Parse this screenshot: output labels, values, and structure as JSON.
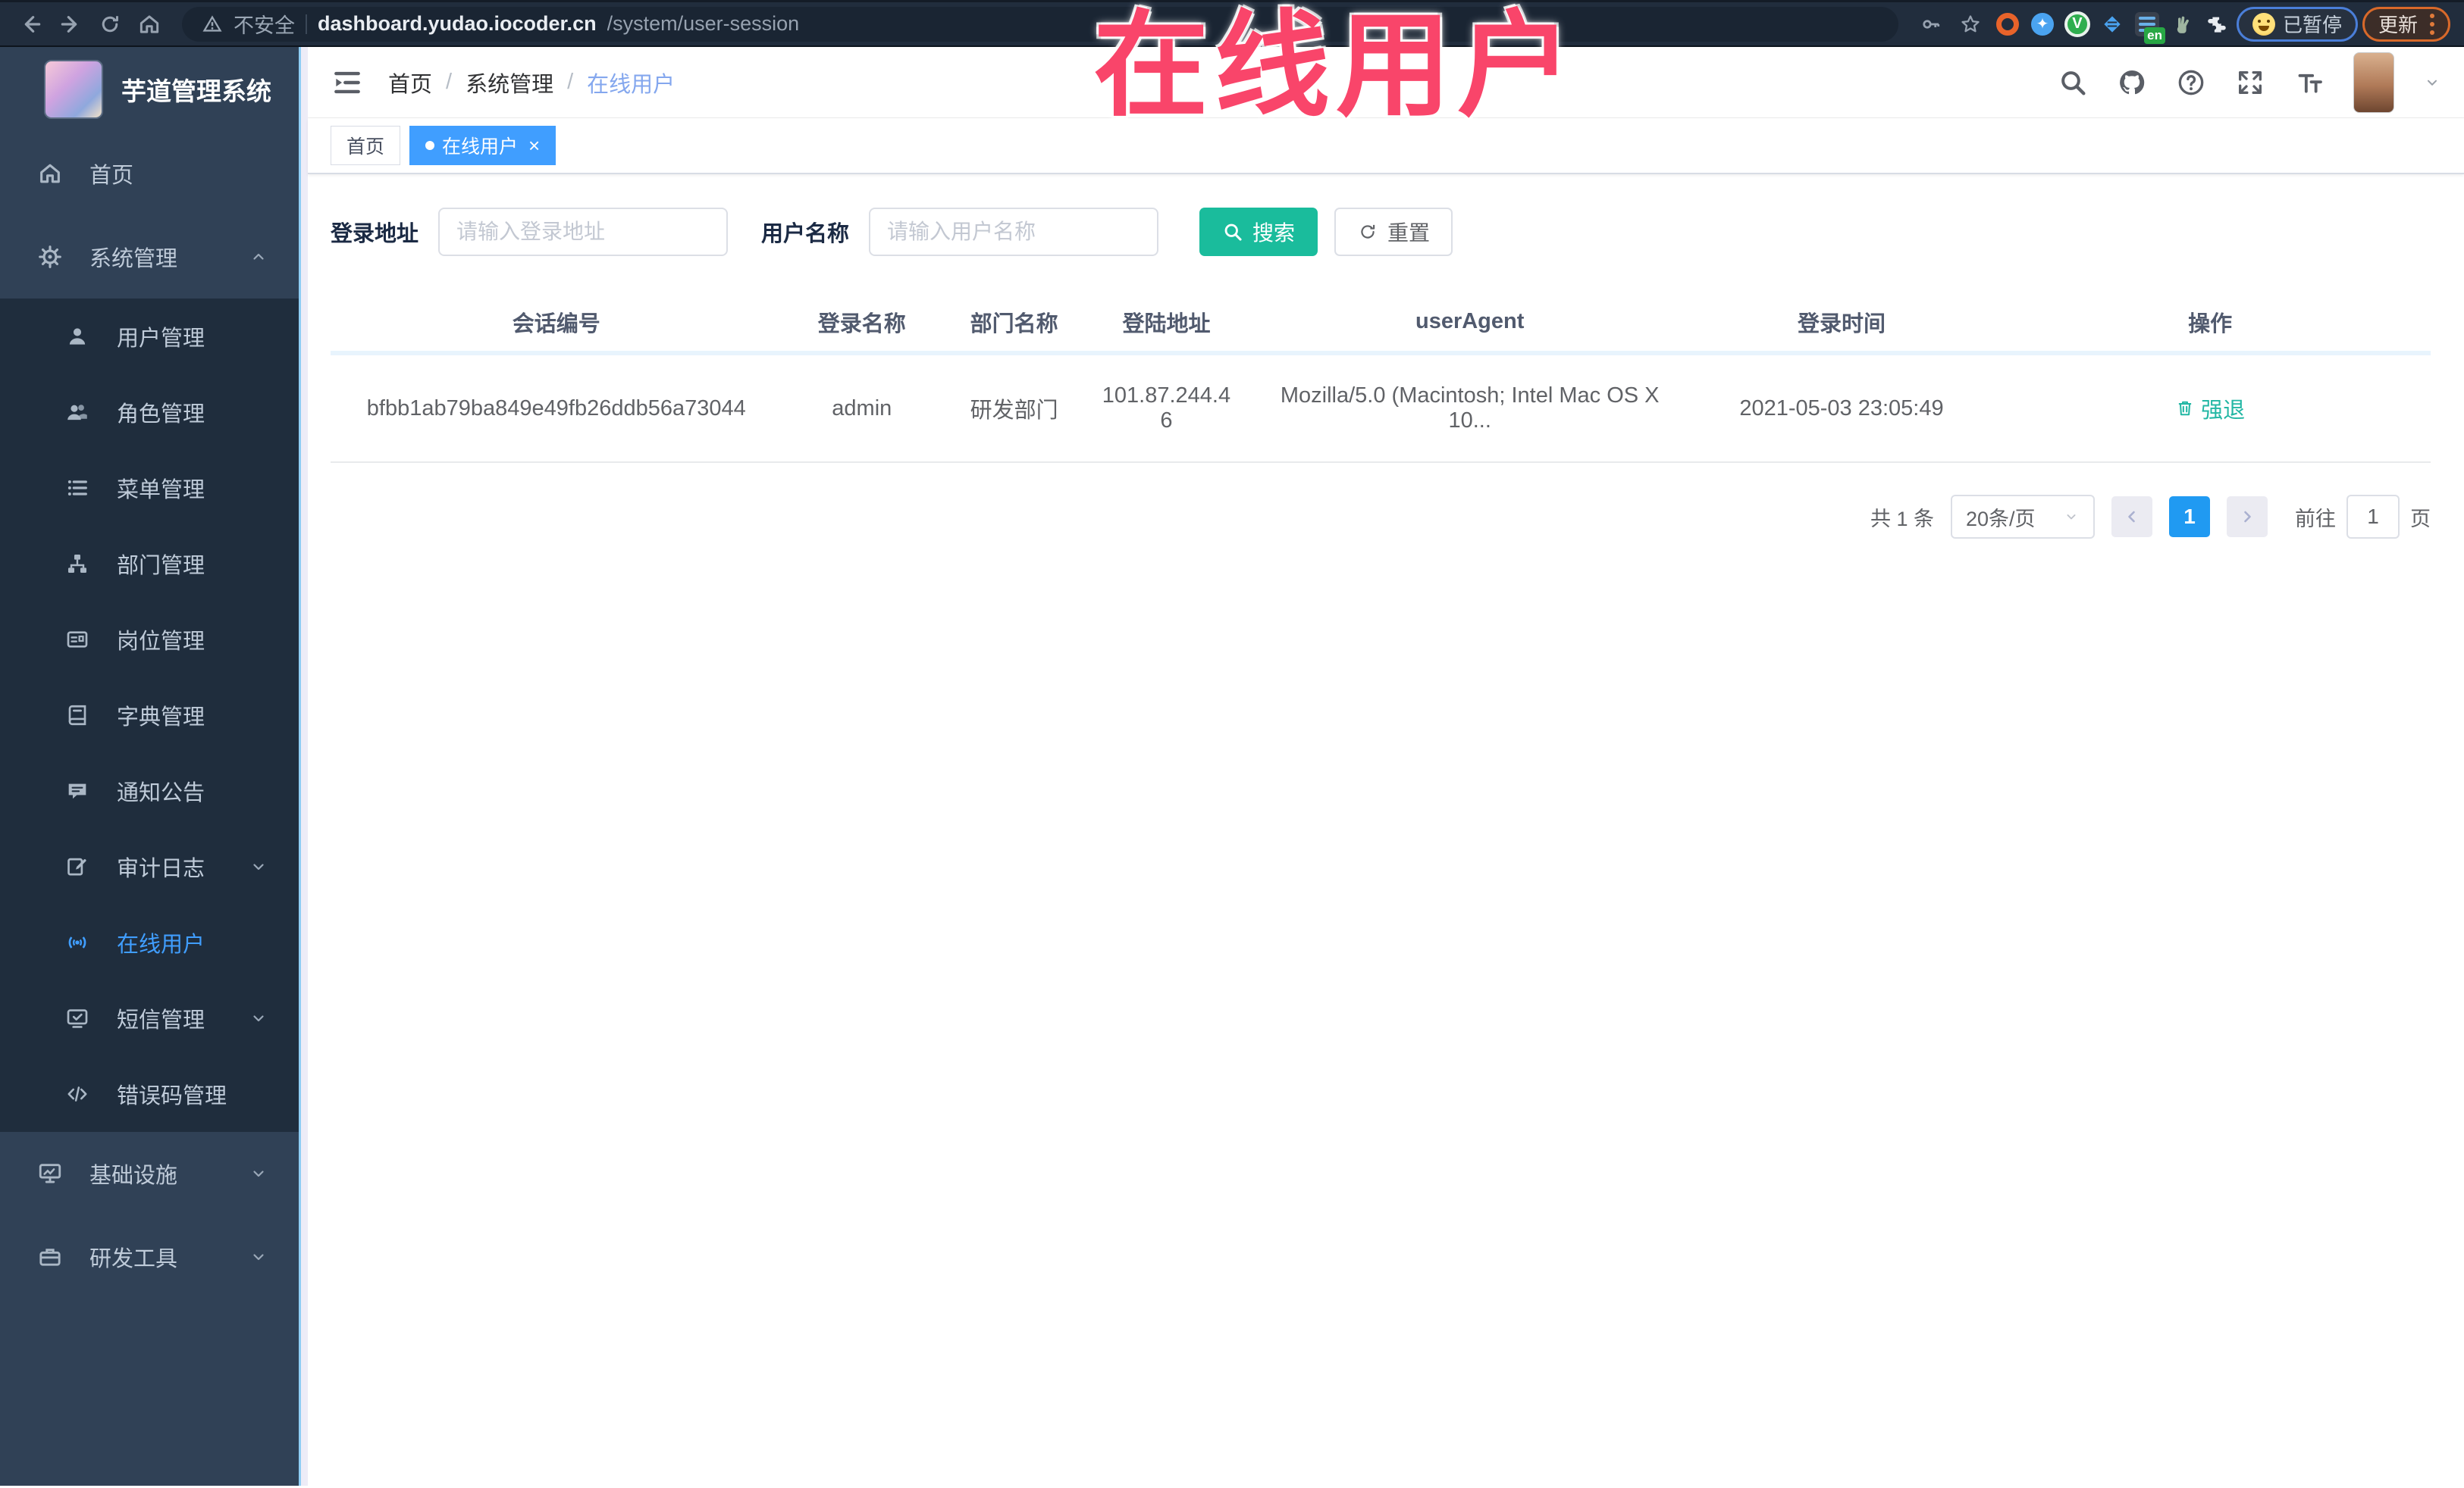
{
  "browser": {
    "security_label": "不安全",
    "url_domain": "dashboard.yudao.iocoder.cn",
    "url_path": "/system/user-session",
    "translate_badge": "en",
    "paused_badge": "已暂停",
    "update_button": "更新"
  },
  "watermark": {
    "text": "在线用户",
    "color": "#f9456a"
  },
  "sidebar": {
    "title": "芋道管理系统",
    "items": [
      {
        "label": "首页",
        "icon": "home-icon",
        "level": 1
      },
      {
        "label": "系统管理",
        "icon": "gear-icon",
        "level": 1,
        "caret": "up",
        "expanded": true
      },
      {
        "label": "用户管理",
        "icon": "user-icon",
        "level": 2
      },
      {
        "label": "角色管理",
        "icon": "users-icon",
        "level": 2
      },
      {
        "label": "菜单管理",
        "icon": "menu-list-icon",
        "level": 2
      },
      {
        "label": "部门管理",
        "icon": "org-tree-icon",
        "level": 2
      },
      {
        "label": "岗位管理",
        "icon": "id-card-icon",
        "level": 2
      },
      {
        "label": "字典管理",
        "icon": "book-icon",
        "level": 2
      },
      {
        "label": "通知公告",
        "icon": "announcement-icon",
        "level": 2
      },
      {
        "label": "审计日志",
        "icon": "audit-log-icon",
        "level": 2,
        "caret": "down"
      },
      {
        "label": "在线用户",
        "icon": "online-user-icon",
        "level": 2,
        "active": true
      },
      {
        "label": "短信管理",
        "icon": "sms-icon",
        "level": 2,
        "caret": "down"
      },
      {
        "label": "错误码管理",
        "icon": "code-icon",
        "level": 2
      },
      {
        "label": "基础设施",
        "icon": "infrastructure-icon",
        "level": 1,
        "caret": "down"
      },
      {
        "label": "研发工具",
        "icon": "dev-tools-icon",
        "level": 1,
        "caret": "down"
      }
    ]
  },
  "breadcrumb": {
    "separator": "/",
    "items": [
      "首页",
      "系统管理",
      "在线用户"
    ]
  },
  "tabs": [
    {
      "label": "首页",
      "active": false
    },
    {
      "label": "在线用户",
      "active": true,
      "close_glyph": "×"
    }
  ],
  "filters": {
    "address_label": "登录地址",
    "address_placeholder": "请输入登录地址",
    "username_label": "用户名称",
    "username_placeholder": "请输入用户名称",
    "search_label": "搜索",
    "reset_label": "重置"
  },
  "table": {
    "columns": [
      "会话编号",
      "登录名称",
      "部门名称",
      "登陆地址",
      "userAgent",
      "登录时间",
      "操作"
    ],
    "rows": [
      {
        "session_id": "bfbb1ab79ba849e49fb26ddb56a73044",
        "username": "admin",
        "department": "研发部门",
        "ip": "101.87.244.46",
        "user_agent": "Mozilla/5.0 (Macintosh; Intel Mac OS X 10...",
        "login_time": "2021-05-03 23:05:49",
        "action_label": "强退"
      }
    ]
  },
  "pagination": {
    "total_text": "共 1 条",
    "page_size": "20条/页",
    "current_page": "1",
    "goto_label": "前往",
    "goto_value": "1",
    "page_label": "页"
  },
  "colors": {
    "accent": "#409eff",
    "search_button": "#1abc9c",
    "action_link": "#23b7a4",
    "sidebar_bg": "#304156",
    "submenu_bg": "#1f2d3d",
    "pagination_active": "#209af2",
    "watermark": "#f9456a"
  }
}
